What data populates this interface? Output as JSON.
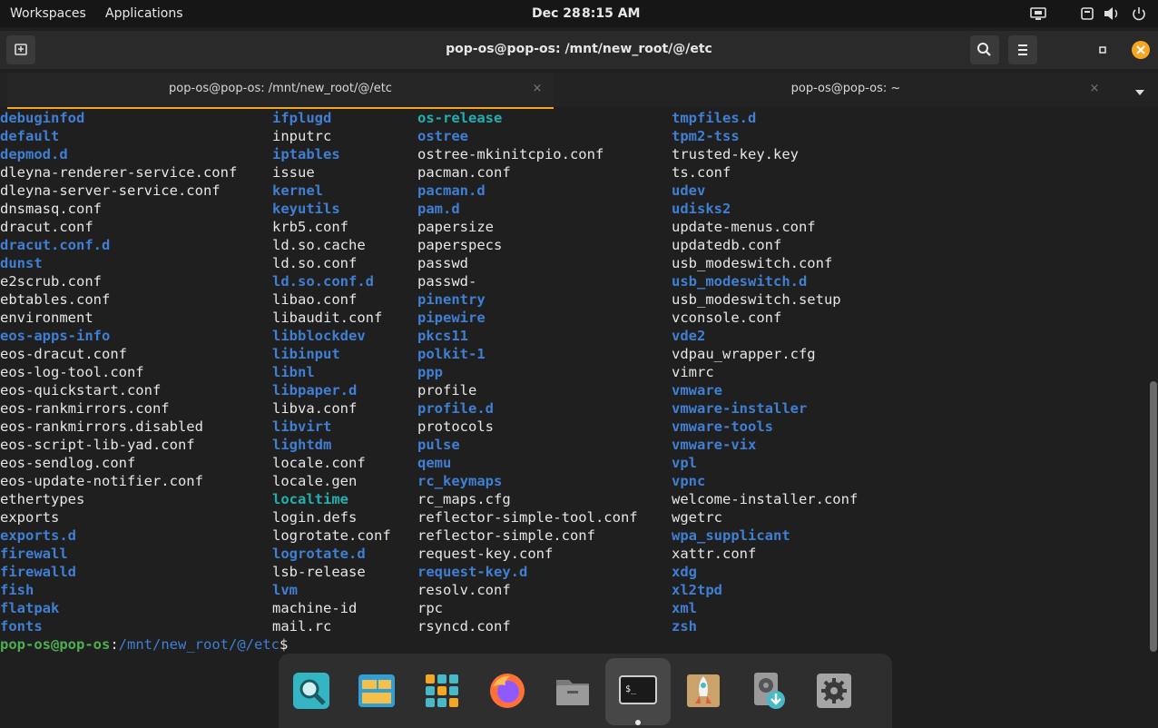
{
  "topbar": {
    "workspaces": "Workspaces",
    "applications": "Applications",
    "date": "Dec 28",
    "time": "8:15 AM"
  },
  "window": {
    "title": "pop-os@pop-os: /mnt/new_root/@/etc"
  },
  "tabs": [
    {
      "label": "pop-os@pop-os: /mnt/new_root/@/etc",
      "active": true
    },
    {
      "label": "pop-os@pop-os: ~",
      "active": false
    }
  ],
  "tab_close_glyph": "×",
  "listing": {
    "col1": [
      {
        "t": "debuginfod",
        "k": "d"
      },
      {
        "t": "default",
        "k": "d"
      },
      {
        "t": "depmod.d",
        "k": "d"
      },
      {
        "t": "dleyna-renderer-service.conf",
        "k": "f"
      },
      {
        "t": "dleyna-server-service.conf",
        "k": "f"
      },
      {
        "t": "dnsmasq.conf",
        "k": "f"
      },
      {
        "t": "dracut.conf",
        "k": "f"
      },
      {
        "t": "dracut.conf.d",
        "k": "d"
      },
      {
        "t": "dunst",
        "k": "d"
      },
      {
        "t": "e2scrub.conf",
        "k": "f"
      },
      {
        "t": "ebtables.conf",
        "k": "f"
      },
      {
        "t": "environment",
        "k": "f"
      },
      {
        "t": "eos-apps-info",
        "k": "d"
      },
      {
        "t": "eos-dracut.conf",
        "k": "f"
      },
      {
        "t": "eos-log-tool.conf",
        "k": "f"
      },
      {
        "t": "eos-quickstart.conf",
        "k": "f"
      },
      {
        "t": "eos-rankmirrors.conf",
        "k": "f"
      },
      {
        "t": "eos-rankmirrors.disabled",
        "k": "f"
      },
      {
        "t": "eos-script-lib-yad.conf",
        "k": "f"
      },
      {
        "t": "eos-sendlog.conf",
        "k": "f"
      },
      {
        "t": "eos-update-notifier.conf",
        "k": "f"
      },
      {
        "t": "ethertypes",
        "k": "f"
      },
      {
        "t": "exports",
        "k": "f"
      },
      {
        "t": "exports.d",
        "k": "d"
      },
      {
        "t": "firewall",
        "k": "d"
      },
      {
        "t": "firewalld",
        "k": "d"
      },
      {
        "t": "fish",
        "k": "d"
      },
      {
        "t": "flatpak",
        "k": "d"
      },
      {
        "t": "fonts",
        "k": "d"
      }
    ],
    "col2": [
      {
        "t": "ifplugd",
        "k": "d"
      },
      {
        "t": "inputrc",
        "k": "f"
      },
      {
        "t": "iptables",
        "k": "d"
      },
      {
        "t": "issue",
        "k": "f"
      },
      {
        "t": "kernel",
        "k": "d"
      },
      {
        "t": "keyutils",
        "k": "d"
      },
      {
        "t": "krb5.conf",
        "k": "f"
      },
      {
        "t": "ld.so.cache",
        "k": "f"
      },
      {
        "t": "ld.so.conf",
        "k": "f"
      },
      {
        "t": "ld.so.conf.d",
        "k": "d"
      },
      {
        "t": "libao.conf",
        "k": "f"
      },
      {
        "t": "libaudit.conf",
        "k": "f"
      },
      {
        "t": "libblockdev",
        "k": "d"
      },
      {
        "t": "libinput",
        "k": "d"
      },
      {
        "t": "libnl",
        "k": "d"
      },
      {
        "t": "libpaper.d",
        "k": "d"
      },
      {
        "t": "libva.conf",
        "k": "f"
      },
      {
        "t": "libvirt",
        "k": "d"
      },
      {
        "t": "lightdm",
        "k": "d"
      },
      {
        "t": "locale.conf",
        "k": "f"
      },
      {
        "t": "locale.gen",
        "k": "f"
      },
      {
        "t": "localtime",
        "k": "l"
      },
      {
        "t": "login.defs",
        "k": "f"
      },
      {
        "t": "logrotate.conf",
        "k": "f"
      },
      {
        "t": "logrotate.d",
        "k": "d"
      },
      {
        "t": "lsb-release",
        "k": "f"
      },
      {
        "t": "lvm",
        "k": "d"
      },
      {
        "t": "machine-id",
        "k": "f"
      },
      {
        "t": "mail.rc",
        "k": "f"
      }
    ],
    "col3": [
      {
        "t": "os-release",
        "k": "l"
      },
      {
        "t": "ostree",
        "k": "d"
      },
      {
        "t": "ostree-mkinitcpio.conf",
        "k": "f"
      },
      {
        "t": "pacman.conf",
        "k": "f"
      },
      {
        "t": "pacman.d",
        "k": "d"
      },
      {
        "t": "pam.d",
        "k": "d"
      },
      {
        "t": "papersize",
        "k": "f"
      },
      {
        "t": "paperspecs",
        "k": "f"
      },
      {
        "t": "passwd",
        "k": "f"
      },
      {
        "t": "passwd-",
        "k": "f"
      },
      {
        "t": "pinentry",
        "k": "d"
      },
      {
        "t": "pipewire",
        "k": "d"
      },
      {
        "t": "pkcs11",
        "k": "d"
      },
      {
        "t": "polkit-1",
        "k": "d"
      },
      {
        "t": "ppp",
        "k": "d"
      },
      {
        "t": "profile",
        "k": "f"
      },
      {
        "t": "profile.d",
        "k": "d"
      },
      {
        "t": "protocols",
        "k": "f"
      },
      {
        "t": "pulse",
        "k": "d"
      },
      {
        "t": "qemu",
        "k": "d"
      },
      {
        "t": "rc_keymaps",
        "k": "d"
      },
      {
        "t": "rc_maps.cfg",
        "k": "f"
      },
      {
        "t": "reflector-simple-tool.conf",
        "k": "f"
      },
      {
        "t": "reflector-simple.conf",
        "k": "f"
      },
      {
        "t": "request-key.conf",
        "k": "f"
      },
      {
        "t": "request-key.d",
        "k": "d"
      },
      {
        "t": "resolv.conf",
        "k": "f"
      },
      {
        "t": "rpc",
        "k": "f"
      },
      {
        "t": "rsyncd.conf",
        "k": "f"
      }
    ],
    "col4": [
      {
        "t": "tmpfiles.d",
        "k": "d"
      },
      {
        "t": "tpm2-tss",
        "k": "d"
      },
      {
        "t": "trusted-key.key",
        "k": "f"
      },
      {
        "t": "ts.conf",
        "k": "f"
      },
      {
        "t": "udev",
        "k": "d"
      },
      {
        "t": "udisks2",
        "k": "d"
      },
      {
        "t": "update-menus.conf",
        "k": "f"
      },
      {
        "t": "updatedb.conf",
        "k": "f"
      },
      {
        "t": "usb_modeswitch.conf",
        "k": "f"
      },
      {
        "t": "usb_modeswitch.d",
        "k": "d"
      },
      {
        "t": "usb_modeswitch.setup",
        "k": "f"
      },
      {
        "t": "vconsole.conf",
        "k": "f"
      },
      {
        "t": "vde2",
        "k": "d"
      },
      {
        "t": "vdpau_wrapper.cfg",
        "k": "f"
      },
      {
        "t": "vimrc",
        "k": "f"
      },
      {
        "t": "vmware",
        "k": "d"
      },
      {
        "t": "vmware-installer",
        "k": "d"
      },
      {
        "t": "vmware-tools",
        "k": "d"
      },
      {
        "t": "vmware-vix",
        "k": "d"
      },
      {
        "t": "vpl",
        "k": "d"
      },
      {
        "t": "vpnc",
        "k": "d"
      },
      {
        "t": "welcome-installer.conf",
        "k": "f"
      },
      {
        "t": "wgetrc",
        "k": "f"
      },
      {
        "t": "wpa_supplicant",
        "k": "d"
      },
      {
        "t": "xattr.conf",
        "k": "f"
      },
      {
        "t": "xdg",
        "k": "d"
      },
      {
        "t": "xl2tpd",
        "k": "d"
      },
      {
        "t": "xml",
        "k": "d"
      },
      {
        "t": "zsh",
        "k": "d"
      }
    ]
  },
  "prompt": {
    "user_host": "pop-os@pop-os",
    "sep": ":",
    "path": "/mnt/new_root/@/etc",
    "symbol": "$"
  },
  "dock": [
    {
      "name": "search-app-icon",
      "active": false
    },
    {
      "name": "workspaces-app-icon",
      "active": false
    },
    {
      "name": "app-grid-icon",
      "active": false
    },
    {
      "name": "firefox-icon",
      "active": false
    },
    {
      "name": "files-icon",
      "active": false
    },
    {
      "name": "terminal-icon",
      "active": true
    },
    {
      "name": "pop-shop-icon",
      "active": false
    },
    {
      "name": "disk-installer-icon",
      "active": false
    },
    {
      "name": "settings-icon",
      "active": false
    }
  ],
  "terminal_glyph": "$_",
  "colors": {
    "file": "#e6e6e6",
    "directory": "#3f7fd4",
    "symlink": "#20b0b0",
    "prompt_user": "#4caf50",
    "tab_accent": "#f5a623",
    "close_button": "#f5a623"
  }
}
